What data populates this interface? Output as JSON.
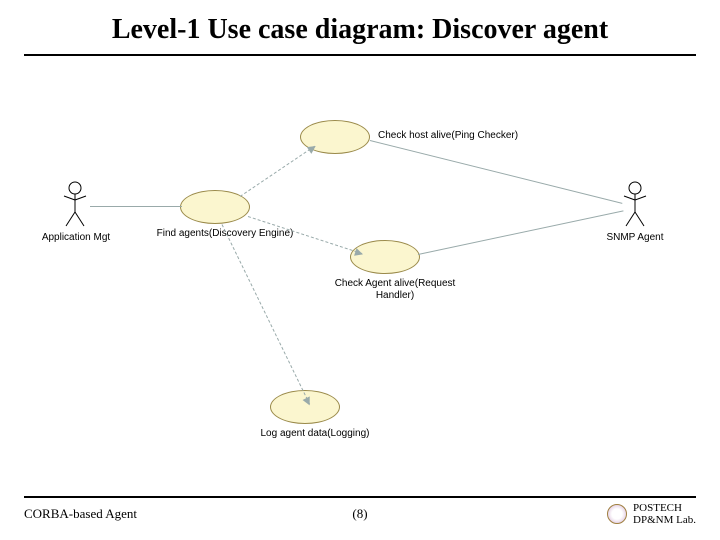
{
  "title": "Level-1 Use case diagram: Discover agent",
  "actors": {
    "left": {
      "label": "Application Mgt"
    },
    "right": {
      "label": "SNMP Agent"
    }
  },
  "usecases": {
    "ping": {
      "label": "Check host alive(Ping Checker)"
    },
    "discovery": {
      "label": "Find agents(Discovery Engine)"
    },
    "request": {
      "label": "Check Agent alive(Request Handler)"
    },
    "logging": {
      "label": "Log agent data(Logging)"
    }
  },
  "footer": {
    "left": "CORBA-based Agent",
    "center": "(8)",
    "lab_line1": "POSTECH",
    "lab_line2": "DP&NM Lab."
  }
}
